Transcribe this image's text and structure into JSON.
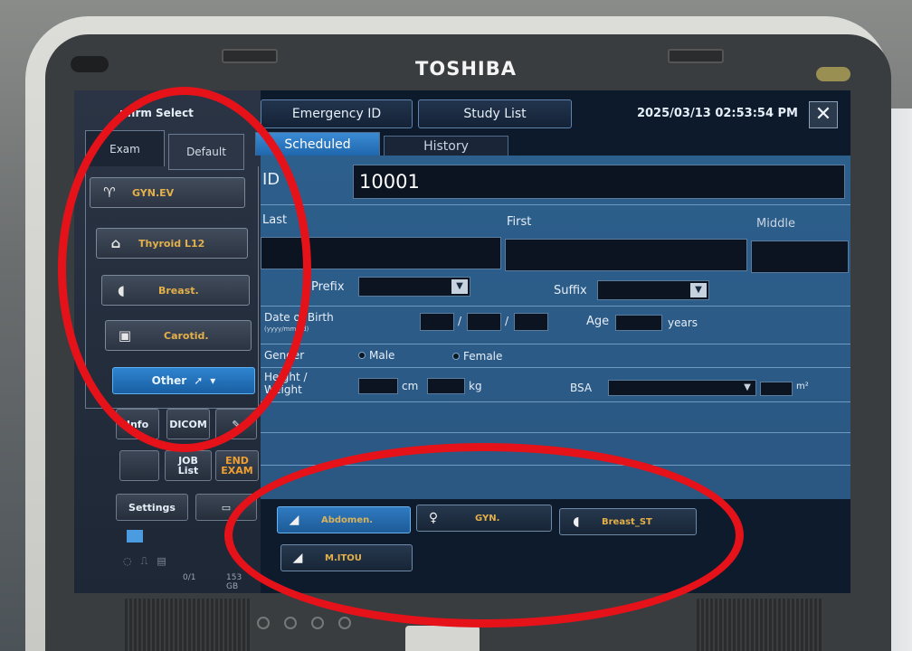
{
  "device": {
    "brand": "TOSHIBA"
  },
  "left_panel": {
    "title": "nfirm Select",
    "tabs": {
      "exam": "Exam",
      "default": "Default"
    },
    "presets": [
      {
        "label": "GYN.EV",
        "icon": "uterus-icon"
      },
      {
        "label": "Thyroid L12",
        "icon": "thyroid-icon"
      },
      {
        "label": "Breast.",
        "icon": "breast-icon"
      },
      {
        "label": "Carotid.",
        "icon": "carotid-icon"
      }
    ],
    "other_label": "Other",
    "info_label": "Info",
    "dicom_label": "DICOM",
    "job_list_label": "JOB\nList",
    "end_exam_label": "END\nEXAM",
    "settings_label": "Settings",
    "tray_count": "0/1",
    "tray_size": "153 GB"
  },
  "header": {
    "emergency_id": "Emergency ID",
    "study_list": "Study List",
    "datetime": "2025/03/13 02:53:54 PM",
    "close": "✕",
    "tabs": {
      "scheduled": "Scheduled",
      "history": "History"
    }
  },
  "form": {
    "id_label": "ID",
    "id_value": "10001",
    "last_label": "Last",
    "first_label": "First",
    "middle_label": "Middle",
    "prefix_label": "Prefix",
    "suffix_label": "Suffix",
    "dob_label": "Date of Birth",
    "dob_hint": "(yyyy/mm/dd)",
    "dob_sep": "/",
    "age_label": "Age",
    "years_label": "years",
    "gender_label": "Gender",
    "male_label": "Male",
    "female_label": "Female",
    "hw_label": "Height /\nWeight",
    "cm_label": "cm",
    "kg_label": "kg",
    "bsa_label": "BSA",
    "m2_label": "m²"
  },
  "exam_buttons": [
    {
      "label": "Abdomen.",
      "icon": "abdomen-probe-icon",
      "selected": true
    },
    {
      "label": "GYN.",
      "icon": "person-icon",
      "selected": false
    },
    {
      "label": "Breast_ST",
      "icon": "breast-probe-icon",
      "selected": false
    },
    {
      "label": "M.ITOU",
      "icon": "probe-icon",
      "selected": false
    }
  ],
  "colors": {
    "annotation_red": "#e5121a",
    "preset_text": "#e3b04a",
    "active_tab": "#2f7ac0"
  }
}
